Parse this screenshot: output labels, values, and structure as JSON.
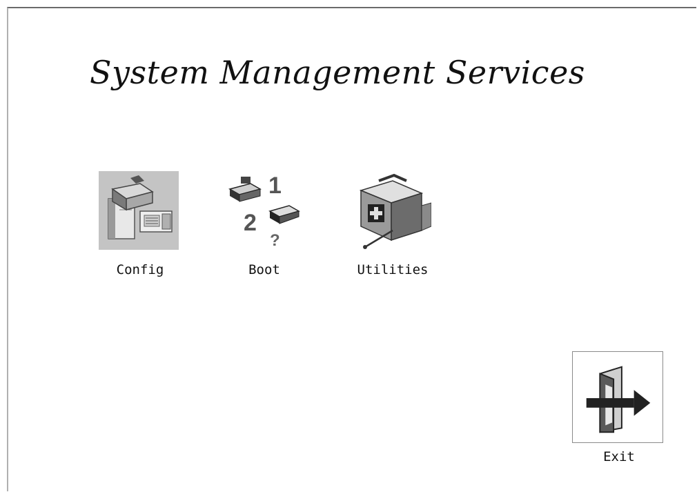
{
  "screen": {
    "title": "System Management Services"
  },
  "menu": {
    "items": [
      {
        "label": "Config",
        "icon": "config-icon",
        "selected": true
      },
      {
        "label": "Boot",
        "icon": "boot-icon",
        "selected": false
      },
      {
        "label": "Utilities",
        "icon": "utilities-icon",
        "selected": false
      }
    ]
  },
  "exit": {
    "label": "Exit",
    "icon": "exit-door-arrow-icon"
  },
  "colors": {
    "background": "#ffffff",
    "selection": "#c4c4c4",
    "text": "#111111"
  }
}
